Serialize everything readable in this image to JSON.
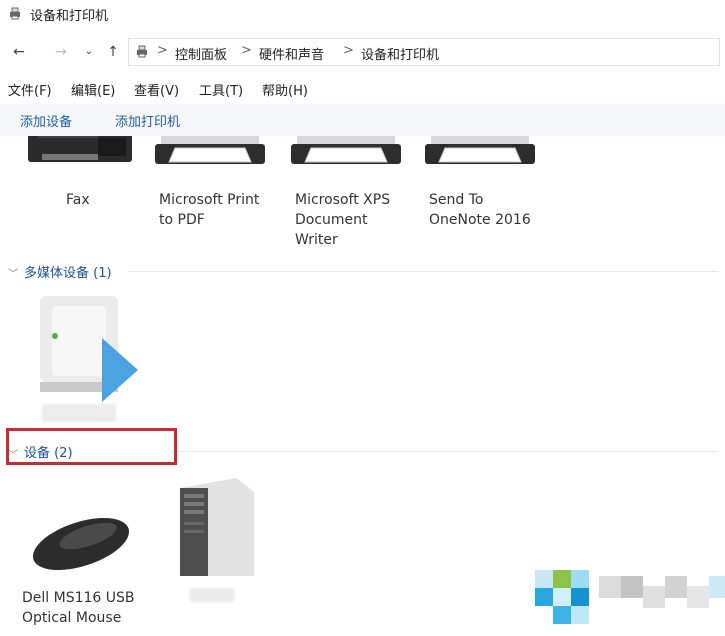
{
  "window": {
    "title": "设备和打印机"
  },
  "address_bar": {
    "crumbs": [
      "控制面板",
      "硬件和声音",
      "设备和打印机"
    ],
    "separator": ">"
  },
  "menu": [
    "文件(F)",
    "编辑(E)",
    "查看(V)",
    "工具(T)",
    "帮助(H)"
  ],
  "commands": [
    "添加设备",
    "添加打印机"
  ],
  "printers": [
    {
      "label": "Fax"
    },
    {
      "label": "Microsoft Print\nto PDF"
    },
    {
      "label": "Microsoft XPS\nDocument\nWriter"
    },
    {
      "label": "Send To\nOneNote 2016"
    }
  ],
  "groups": {
    "multimedia": {
      "title": "多媒体设备 (1)"
    },
    "devices": {
      "title": "设备 (2)"
    }
  },
  "devices": [
    {
      "label": "Dell MS116 USB\nOptical Mouse"
    }
  ],
  "colors": {
    "highlight": "#d6262b",
    "link": "#1f4e99"
  }
}
